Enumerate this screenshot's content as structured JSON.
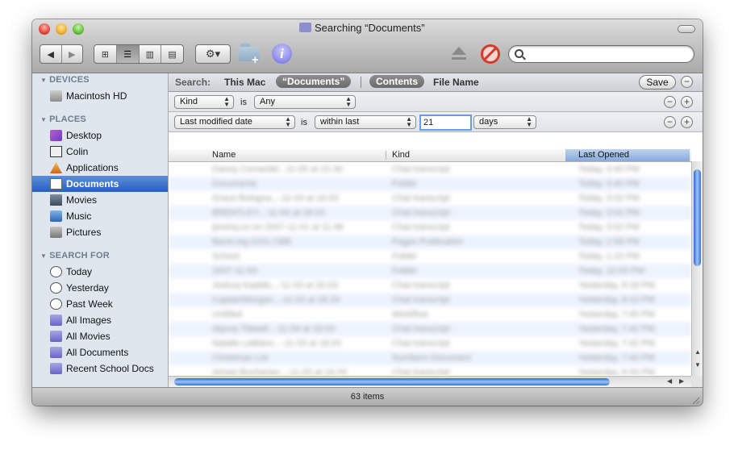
{
  "window": {
    "title": "Searching “Documents”",
    "status_text": "63 items"
  },
  "toolbar": {
    "back_icon": "back-arrow-icon",
    "forward_icon": "forward-arrow-icon",
    "view_modes": [
      "icon-view",
      "list-view",
      "column-view",
      "coverflow-view"
    ],
    "active_view": "list-view",
    "action_label": "⚙",
    "search_value": ""
  },
  "sidebar": {
    "devices_header": "DEVICES",
    "devices": [
      {
        "label": "Macintosh HD",
        "icon": "hard-drive-icon"
      }
    ],
    "places_header": "PLACES",
    "places": [
      {
        "label": "Desktop",
        "icon": "desktop-icon"
      },
      {
        "label": "Colin",
        "icon": "home-icon"
      },
      {
        "label": "Applications",
        "icon": "applications-icon"
      },
      {
        "label": "Documents",
        "icon": "documents-icon",
        "selected": true
      },
      {
        "label": "Movies",
        "icon": "movies-icon"
      },
      {
        "label": "Music",
        "icon": "music-icon"
      },
      {
        "label": "Pictures",
        "icon": "pictures-icon"
      }
    ],
    "search_header": "SEARCH FOR",
    "searches": [
      {
        "label": "Today",
        "icon": "clock-icon"
      },
      {
        "label": "Yesterday",
        "icon": "clock-icon"
      },
      {
        "label": "Past Week",
        "icon": "clock-icon"
      },
      {
        "label": "All Images",
        "icon": "smart-folder-icon"
      },
      {
        "label": "All Movies",
        "icon": "smart-folder-icon"
      },
      {
        "label": "All Documents",
        "icon": "smart-folder-icon"
      },
      {
        "label": "Recent School Docs",
        "icon": "smart-folder-icon"
      }
    ]
  },
  "scope": {
    "label": "Search:",
    "this_mac": "This Mac",
    "documents": "“Documents”",
    "contents": "Contents",
    "file_name": "File Name",
    "save": "Save"
  },
  "criteria": [
    {
      "attribute": "Kind",
      "operator_text": "is",
      "value": "Any"
    },
    {
      "attribute": "Last modified date",
      "operator_text": "is",
      "comparison": "within last",
      "amount": "21",
      "unit": "days"
    }
  ],
  "columns": {
    "name": "Name",
    "kind": "Kind",
    "last_opened": "Last Opened"
  },
  "rows": [
    {
      "name": "Danny Comardel...11-05 at 15.30",
      "kind": "Chat transcript",
      "date": "Today, 3:40 PM"
    },
    {
      "name": "Documents",
      "kind": "Folder",
      "date": "Today, 3:40 PM"
    },
    {
      "name": "Grace Bologna...-11-04 at 18.03",
      "kind": "Chat transcript",
      "date": "Today, 3:02 PM"
    },
    {
      "name": "BRENTLEY...-11-04 at 18.03",
      "kind": "Chat transcript",
      "date": "Today, 3:02 PM"
    },
    {
      "name": "jeremy.co on 2007-11-01 at 11.48",
      "kind": "Chat transcript",
      "date": "Today, 3:02 PM"
    },
    {
      "name": "Band.org.2231.CBB",
      "kind": "Pages Publication",
      "date": "Today, 2:58 PM"
    },
    {
      "name": "School",
      "kind": "Folder",
      "date": "Today, 1:15 PM"
    },
    {
      "name": "2007-11-03",
      "kind": "Folder",
      "date": "Today, 12:03 PM"
    },
    {
      "name": "Joshua Kaddio...-11-03 at 20.03",
      "kind": "Chat transcript",
      "date": "Yesterday, 8:18 PM"
    },
    {
      "name": "CaptainMorgan...-11-03 at 18.33",
      "kind": "Chat transcript",
      "date": "Yesterday, 8:16 PM"
    },
    {
      "name": "Untitled",
      "kind": "Workflow",
      "date": "Yesterday, 7:45 PM"
    },
    {
      "name": "Alyssa Tidwell...-11-04 at 18.03",
      "kind": "Chat transcript",
      "date": "Yesterday, 7:42 PM"
    },
    {
      "name": "Natalie LeBlanc...-11-03 at 18.03",
      "kind": "Chat transcript",
      "date": "Yesterday, 7:42 PM"
    },
    {
      "name": "Christmas List",
      "kind": "Numbers Document",
      "date": "Yesterday, 7:40 PM"
    },
    {
      "name": "Aimee Buchanan...-11-03 at 18.33",
      "kind": "Chat transcript",
      "date": "Yesterday, 6:34 PM"
    }
  ]
}
